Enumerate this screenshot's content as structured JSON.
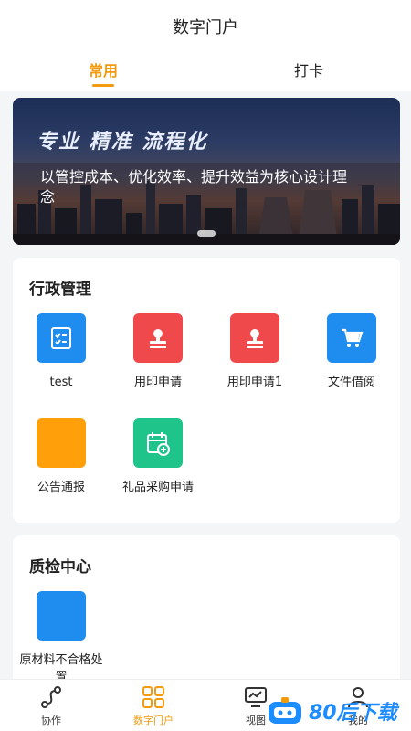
{
  "header": {
    "title": "数字门户"
  },
  "tabs": [
    {
      "label": "常用",
      "active": true
    },
    {
      "label": "打卡",
      "active": false
    }
  ],
  "banner": {
    "slogan": "专业 精准 流程化",
    "subtitle": "以管控成本、优化效率、提升效益为核心设计理念"
  },
  "sections": [
    {
      "title": "行政管理",
      "apps": [
        {
          "label": "test",
          "icon": "checklist-icon",
          "color": "#1f8cf0"
        },
        {
          "label": "用印申请",
          "icon": "stamp-icon",
          "color": "#f0494c"
        },
        {
          "label": "用印申请1",
          "icon": "stamp-icon",
          "color": "#f0494c"
        },
        {
          "label": "文件借阅",
          "icon": "cart-icon",
          "color": "#1f8cf0"
        },
        {
          "label": "公告通报",
          "icon": "blank-icon",
          "color": "#ff9f0a"
        },
        {
          "label": "礼品采购申请",
          "icon": "calendar-add-icon",
          "color": "#1ec48a"
        }
      ]
    },
    {
      "title": "质检中心",
      "apps": [
        {
          "label": "原材料不合格处置",
          "icon": "blank-icon",
          "color": "#1f8cf0"
        }
      ]
    }
  ],
  "bottom_nav": [
    {
      "label": "协作",
      "icon": "flow-icon",
      "active": false
    },
    {
      "label": "数字门户",
      "icon": "grid-icon",
      "active": true
    },
    {
      "label": "视图",
      "icon": "monitor-icon",
      "active": false
    },
    {
      "label": "我的",
      "icon": "user-icon",
      "active": false
    }
  ],
  "watermark": {
    "text": "80后下载"
  },
  "colors": {
    "accent": "#f49a0f",
    "blue": "#1f8cf0",
    "red": "#f0494c",
    "orange": "#ff9f0a",
    "green": "#1ec48a"
  }
}
